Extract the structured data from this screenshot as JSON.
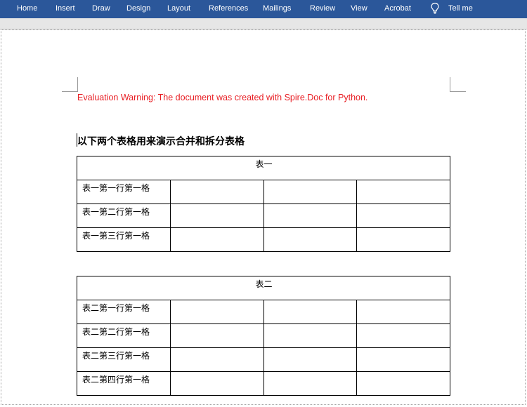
{
  "ribbon": {
    "tabs": [
      "Home",
      "Insert",
      "Draw",
      "Design",
      "Layout",
      "References",
      "Mailings",
      "Review",
      "View",
      "Acrobat"
    ],
    "tell_me": "Tell me",
    "color": "#2b579a"
  },
  "document": {
    "warning": "Evaluation Warning: The document was created with Spire.Doc for Python.",
    "warning_color": "#e81d23",
    "heading": "以下两个表格用来演示合并和拆分表格",
    "table1": {
      "title": "表一",
      "rows": [
        "表一第一行第一格",
        "表一第二行第一格",
        "表一第三行第一格"
      ]
    },
    "table2": {
      "title": "表二",
      "rows": [
        "表二第一行第一格",
        "表二第二行第一格",
        "表二第三行第一格",
        "表二第四行第一格"
      ]
    }
  }
}
